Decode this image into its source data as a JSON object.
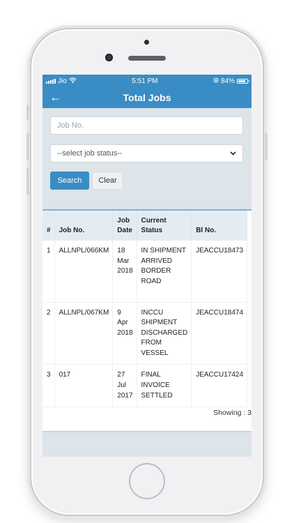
{
  "status_bar": {
    "carrier": "Jio",
    "time": "5:51 PM",
    "battery_percent": "84%",
    "battery_level": 0.84
  },
  "navbar": {
    "title": "Total Jobs",
    "back_icon": "arrow-left-icon"
  },
  "filters": {
    "job_no_placeholder": "Job No.",
    "status_select_value": "--select job status--",
    "search_label": "Search",
    "clear_label": "Clear"
  },
  "table": {
    "headers": [
      "#",
      "Job No.",
      "Job Date",
      "Current Status",
      "Bl No."
    ],
    "rows": [
      {
        "num": "1",
        "job_no": "ALLNPL/066KM",
        "job_date": "18 Mar 2018",
        "status": "IN SHIPMENT ARRIVED BORDER ROAD",
        "bl_no": "JEACCU18473"
      },
      {
        "num": "2",
        "job_no": "ALLNPL/067KM",
        "job_date": "9 Apr 2018",
        "status": "INCCU SHIPMENT DISCHARGED FROM VESSEL",
        "bl_no": "JEACCU18474"
      },
      {
        "num": "3",
        "job_no": "017",
        "job_date": "27 Jul 2017",
        "status": "FINAL INVOICE SETTLED",
        "bl_no": "JEACCU17424"
      }
    ]
  },
  "footer": {
    "showing_text": "Showing : 3"
  },
  "colors": {
    "primary": "#3a8dc4",
    "screen_bg": "#dde4ea",
    "header_bg": "#e4ecf3"
  }
}
